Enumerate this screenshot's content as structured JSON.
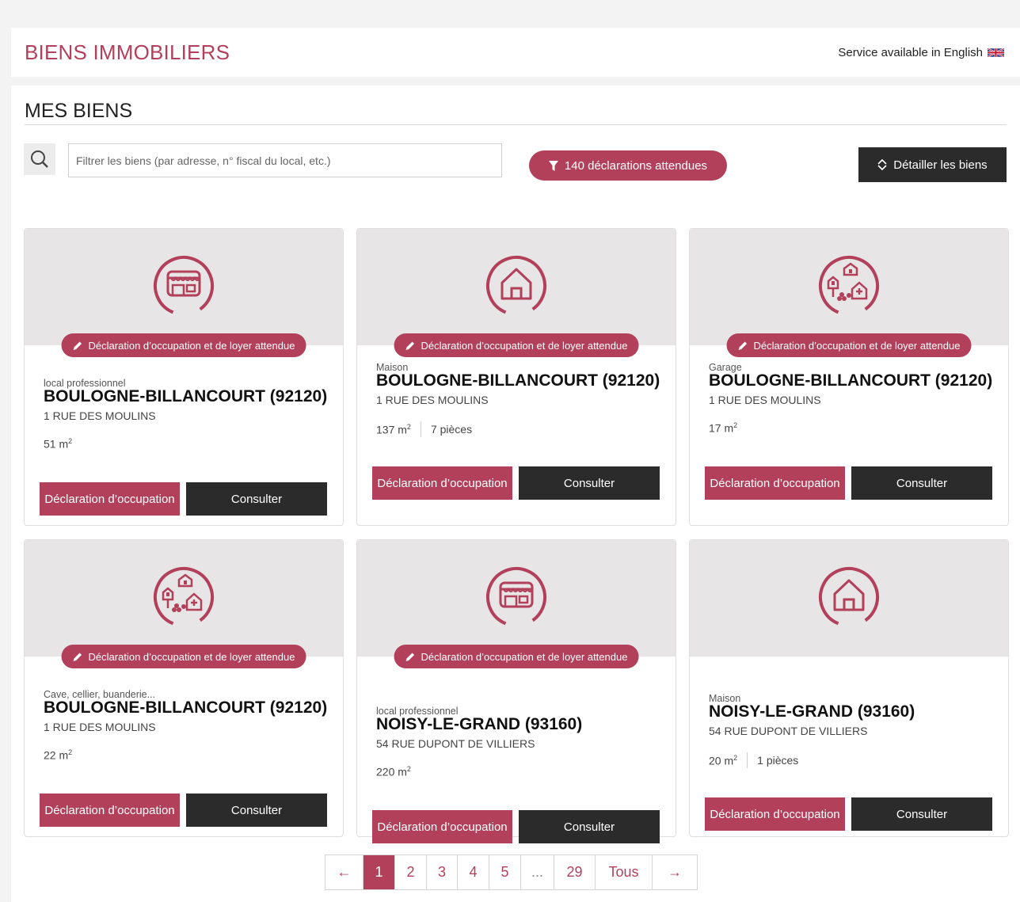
{
  "header": {
    "title": "BIENS IMMOBILIERS",
    "language_link": "Service available in English"
  },
  "section": {
    "title": "MES BIENS"
  },
  "search": {
    "placeholder": "Filtrer les biens (par adresse, n° fiscal du local, etc.)",
    "value": ""
  },
  "filter_pill": {
    "label": "140 déclarations attendues"
  },
  "detail_button": {
    "label": "Détailler les biens"
  },
  "card_labels": {
    "badge": "Déclaration d’occupation et de loyer attendue",
    "declaration_button": "Déclaration d’occupation",
    "consult_button": "Consulter",
    "area_unit": "m",
    "area_exponent": "2"
  },
  "cards": [
    {
      "icon": "shop-icon",
      "badge": true,
      "type": "local professionnel",
      "city": "BOULOGNE-BILLANCOURT (92120)",
      "address": "1 RUE DES MOULINS",
      "area": "51",
      "rooms": ""
    },
    {
      "icon": "house-icon",
      "badge": true,
      "type": "Maison",
      "city": "BOULOGNE-BILLANCOURT (92120)",
      "address": "1 RUE DES MOULINS",
      "area": "137",
      "rooms": "7 pièces"
    },
    {
      "icon": "misc-property-icon",
      "badge": true,
      "type": "Garage",
      "city": "BOULOGNE-BILLANCOURT (92120)",
      "address": "1 RUE DES MOULINS",
      "area": "17",
      "rooms": ""
    },
    {
      "icon": "misc-property-icon",
      "badge": true,
      "type": "Cave, cellier, buanderie...",
      "city": "BOULOGNE-BILLANCOURT (92120)",
      "address": "1 RUE DES MOULINS",
      "area": "22",
      "rooms": ""
    },
    {
      "icon": "shop-icon",
      "badge": true,
      "type": "local professionnel",
      "city": "NOISY-LE-GRAND (93160)",
      "address": "54 RUE DUPONT DE VILLIERS",
      "area": "220",
      "rooms": ""
    },
    {
      "icon": "house-icon",
      "badge": false,
      "type": "Maison",
      "city": "NOISY-LE-GRAND (93160)",
      "address": "54 RUE DUPONT DE VILLIERS",
      "area": "20",
      "rooms": "1 pièces"
    }
  ],
  "pagination": {
    "prev": "←",
    "pages": [
      "1",
      "2",
      "3",
      "4",
      "5",
      "...",
      "29",
      "Tous"
    ],
    "active": "1",
    "next": "→"
  },
  "colors": {
    "accent": "#b3405a",
    "dark": "#2b2b2b",
    "card_top": "#e7e5e6"
  }
}
